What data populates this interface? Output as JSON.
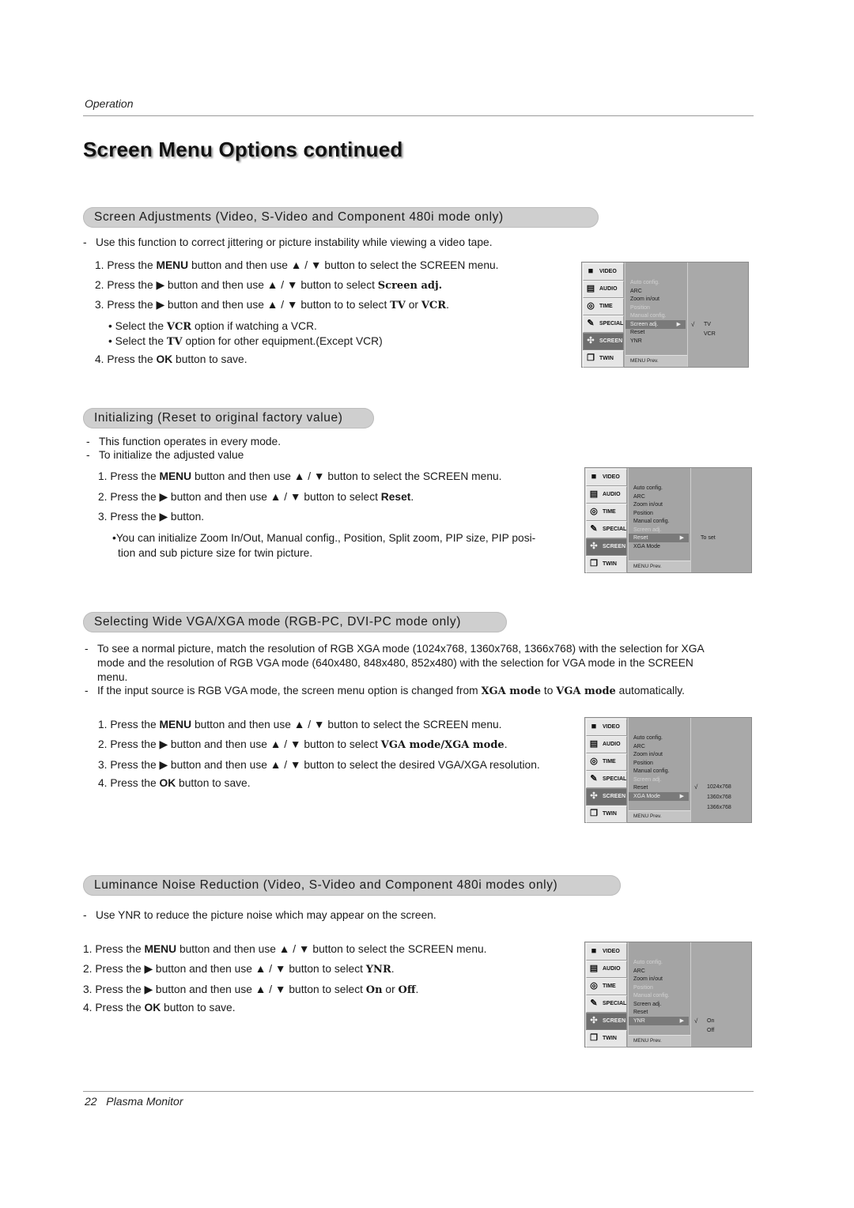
{
  "header": {
    "running_head": "Operation",
    "title": "Screen Menu Options continued"
  },
  "footer": {
    "page_number": "22",
    "doc_title": "Plasma Monitor"
  },
  "osd_tabs": [
    "VIDEO",
    "AUDIO",
    "TIME",
    "SPECIAL",
    "SCREEN",
    "TWIN"
  ],
  "osd_icons": [
    "video-icon",
    "audio-icon",
    "time-icon",
    "special-icon",
    "screen-icon",
    "twin-icon"
  ],
  "osd_footer": "MENU  Prev.",
  "sections": [
    {
      "heading": "Screen Adjustments (Video, S-Video and Component 480i mode only)",
      "notes": [
        "Use this function to correct jittering or picture instability while viewing a video tape."
      ],
      "steps": [
        {
          "num": "1.",
          "pre": "Press the ",
          "b1": "MENU",
          "mid": " button and then use ▲ / ▼  button to select the SCREEN menu."
        },
        {
          "num": "2.",
          "pre": "Press the ▶ button and then use ▲ / ▼  button to select ",
          "b1": "Screen adj.",
          "mid": ""
        },
        {
          "num": "3.",
          "pre": "Press the ▶ button and then use ▲ / ▼ button to to select ",
          "b1": "TV",
          "mid": " or ",
          "b2": "VCR",
          "post": "."
        },
        {
          "num": "4.",
          "pre": "Press the ",
          "b1": "OK",
          "mid": " button to save."
        }
      ],
      "bullets": [
        {
          "pre": "Select the ",
          "b": "VCR",
          "post": " option if watching a VCR."
        },
        {
          "pre": "Select the ",
          "b": "TV",
          "post": " option for other equipment.(Except VCR)"
        }
      ],
      "menu": {
        "items": [
          {
            "label": "Auto config.",
            "dim": true
          },
          {
            "label": "ARC",
            "dim": false
          },
          {
            "label": "Zoom in/out",
            "dim": false
          },
          {
            "label": "Position",
            "dim": true
          },
          {
            "label": "Manual config.",
            "dim": true
          },
          {
            "label": "Screen adj.",
            "selected": true
          },
          {
            "label": "Reset",
            "dim": false
          },
          {
            "label": "YNR",
            "dim": false
          }
        ],
        "options": [
          {
            "label": "TV",
            "checked": true
          },
          {
            "label": "VCR",
            "checked": false
          }
        ]
      }
    },
    {
      "heading": "Initializing (Reset to original factory value)",
      "notes": [
        "This function operates in every mode.",
        "To initialize the adjusted value"
      ],
      "steps": [
        {
          "num": "1.",
          "pre": "Press the ",
          "b1": "MENU",
          "mid": " button and then use ▲ / ▼  button to select the SCREEN menu."
        },
        {
          "num": "2.",
          "pre": "Press the ▶ button and then use ▲ / ▼  button to select ",
          "b1": "Reset",
          "mid": "."
        },
        {
          "num": "3.",
          "pre": "Press the ▶ button."
        }
      ],
      "bullet_1": "You can initialize Zoom In/Out, Manual config., Position, Split zoom, PIP size, PIP posi-",
      "bullet_2": "tion and sub picture size for twin picture.",
      "menu": {
        "items": [
          {
            "label": "Auto config.",
            "dim": false
          },
          {
            "label": "ARC",
            "dim": false
          },
          {
            "label": "Zoom in/out",
            "dim": false
          },
          {
            "label": "Position",
            "dim": false
          },
          {
            "label": "Manual config.",
            "dim": false
          },
          {
            "label": "Screen adj.",
            "dim": true
          },
          {
            "label": "Reset",
            "selected": true
          },
          {
            "label": "XGA Mode",
            "dim": false
          }
        ],
        "options": [
          {
            "label": "To set",
            "checked": false
          }
        ]
      }
    },
    {
      "heading": "Selecting Wide VGA/XGA mode (RGB-PC, DVI-PC mode only)",
      "note_1a": "To see a normal picture, match the resolution of RGB XGA mode (1024x768, 1360x768, 1366x768) with the selection for XGA",
      "note_1b": "mode and the resolution of RGB VGA mode (640x480, 848x480, 852x480) with the selection for VGA mode in the SCREEN",
      "note_1c": "menu.",
      "note_2_pre": "If the input source is RGB VGA mode, the screen menu option is changed from ",
      "note_2_b1": "XGA mode",
      "note_2_mid": " to ",
      "note_2_b2": "VGA mode",
      "note_2_post": " automatically.",
      "steps": [
        {
          "num": "1.",
          "pre": "Press the ",
          "b1": "MENU",
          "mid": " button and then use ▲ / ▼  button to select the SCREEN menu."
        },
        {
          "num": "2.",
          "pre": "Press the ▶ button and then use ▲ / ▼  button to select ",
          "b1": "VGA mode/XGA mode",
          "mid": "."
        },
        {
          "num": "3.",
          "pre": "Press the ▶ button and then use ▲ / ▼ button to select the desired VGA/XGA resolution."
        },
        {
          "num": "4.",
          "pre": "Press the ",
          "b1": "OK",
          "mid": " button to save."
        }
      ],
      "menu": {
        "items": [
          {
            "label": "Auto config.",
            "dim": false
          },
          {
            "label": "ARC",
            "dim": false
          },
          {
            "label": "Zoom in/out",
            "dim": false
          },
          {
            "label": "Position",
            "dim": false
          },
          {
            "label": "Manual config.",
            "dim": false
          },
          {
            "label": "Screen adj.",
            "dim": true
          },
          {
            "label": "Reset",
            "dim": false
          },
          {
            "label": "XGA Mode",
            "selected": true
          }
        ],
        "options": [
          {
            "label": "1024x768",
            "checked": true
          },
          {
            "label": "1360x768",
            "checked": false
          },
          {
            "label": "1366x768",
            "checked": false
          }
        ]
      }
    },
    {
      "heading": "Luminance Noise Reduction (Video, S-Video and Component 480i modes only)",
      "notes": [
        "Use YNR to reduce the picture noise which may appear on the screen."
      ],
      "steps": [
        {
          "num": "1.",
          "pre": "Press the ",
          "b1": "MENU",
          "mid": " button and then use ▲ / ▼  button to select the SCREEN menu."
        },
        {
          "num": "2.",
          "pre": "Press the ▶ button and then use ▲ / ▼  button to select ",
          "b1": "YNR",
          "mid": "."
        },
        {
          "num": "3.",
          "pre": "Press the ▶ button and then use ▲ / ▼  button to select ",
          "b1": "On",
          "mid": " or ",
          "b2": "Off",
          "post": "."
        },
        {
          "num": "4.",
          "pre": "Press the ",
          "b1": "OK",
          "mid": " button to save."
        }
      ],
      "menu": {
        "items": [
          {
            "label": "Auto config.",
            "dim": true
          },
          {
            "label": "ARC",
            "dim": false
          },
          {
            "label": "Zoom in/out",
            "dim": false
          },
          {
            "label": "Position",
            "dim": true
          },
          {
            "label": "Manual config.",
            "dim": true
          },
          {
            "label": "Screen adj.",
            "dim": false
          },
          {
            "label": "Reset",
            "dim": false
          },
          {
            "label": "YNR",
            "selected": true
          }
        ],
        "options": [
          {
            "label": "On",
            "checked": true
          },
          {
            "label": "Off",
            "checked": false
          }
        ]
      }
    }
  ]
}
